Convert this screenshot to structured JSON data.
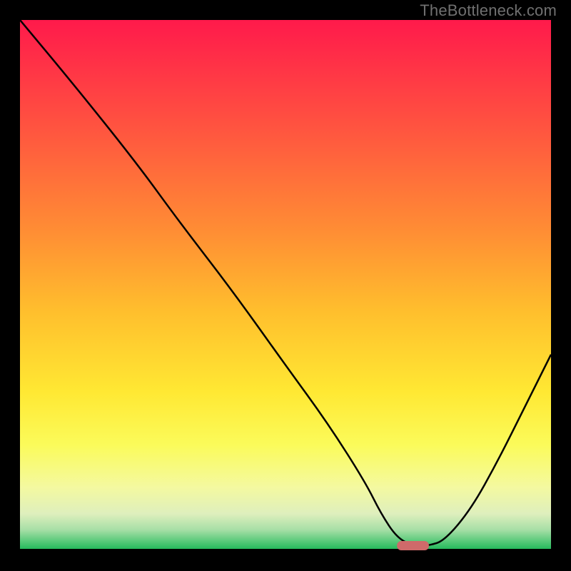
{
  "watermark": "TheBottleneck.com",
  "chart_data": {
    "type": "line",
    "title": "",
    "xlabel": "",
    "ylabel": "",
    "xlim": [
      0,
      100
    ],
    "ylim": [
      0,
      100
    ],
    "grid": false,
    "legend": false,
    "series": [
      {
        "name": "bottleneck-curve",
        "x": [
          0,
          10,
          22,
          30,
          40,
          50,
          58,
          65,
          68,
          71,
          74,
          77,
          80,
          85,
          90,
          95,
          100
        ],
        "y": [
          100,
          88,
          73,
          62,
          49,
          35,
          24,
          13,
          7,
          2.5,
          1,
          1,
          2,
          8,
          17,
          27,
          37
        ],
        "color": "#000000"
      }
    ],
    "marker": {
      "name": "optimal-point",
      "x_center": 74,
      "width": 6,
      "color": "#cf6a6a"
    },
    "background_gradient": {
      "stops": [
        {
          "offset": 0,
          "color": "#ff1a4b"
        },
        {
          "offset": 20,
          "color": "#ff5340"
        },
        {
          "offset": 40,
          "color": "#ff8e34"
        },
        {
          "offset": 55,
          "color": "#ffbf2d"
        },
        {
          "offset": 70,
          "color": "#ffe833"
        },
        {
          "offset": 80,
          "color": "#fbfb5a"
        },
        {
          "offset": 88,
          "color": "#f4f9a0"
        },
        {
          "offset": 93,
          "color": "#deefbd"
        },
        {
          "offset": 96,
          "color": "#a7dfa6"
        },
        {
          "offset": 98,
          "color": "#5ecb7d"
        },
        {
          "offset": 100,
          "color": "#18b554"
        }
      ]
    }
  }
}
